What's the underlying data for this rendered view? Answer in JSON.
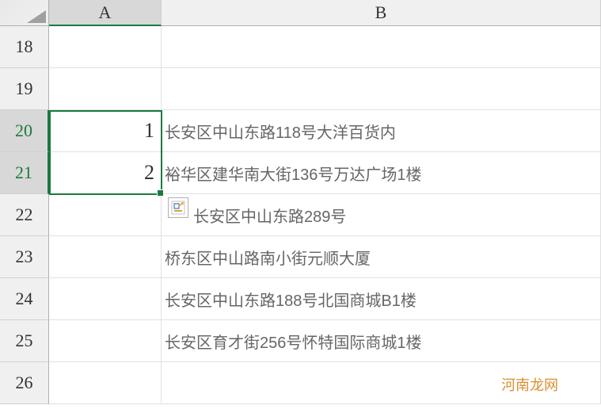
{
  "column_headers": [
    "A",
    "B"
  ],
  "row_numbers": [
    18,
    19,
    20,
    21,
    22,
    23,
    24,
    25,
    26
  ],
  "selected_rows": [
    20,
    21
  ],
  "selected_cols": [
    "A"
  ],
  "rows": [
    {
      "row": 18,
      "A": "",
      "B": ""
    },
    {
      "row": 19,
      "A": "",
      "B": ""
    },
    {
      "row": 20,
      "A": "1",
      "B": "长安区中山东路118号大洋百货内"
    },
    {
      "row": 21,
      "A": "2",
      "B": "裕华区建华南大街136号万达广场1楼"
    },
    {
      "row": 22,
      "A": "",
      "B": "长安区中山东路289号"
    },
    {
      "row": 23,
      "A": "",
      "B": "桥东区中山路南小街元顺大厦"
    },
    {
      "row": 24,
      "A": "",
      "B": "长安区中山东路188号北国商城B1楼"
    },
    {
      "row": 25,
      "A": "",
      "B": "长安区育才街256号怀特国际商城1楼"
    },
    {
      "row": 26,
      "A": "",
      "B": ""
    }
  ],
  "watermark": "河南龙网",
  "row22_b_padding": "长安区中山东路289号"
}
